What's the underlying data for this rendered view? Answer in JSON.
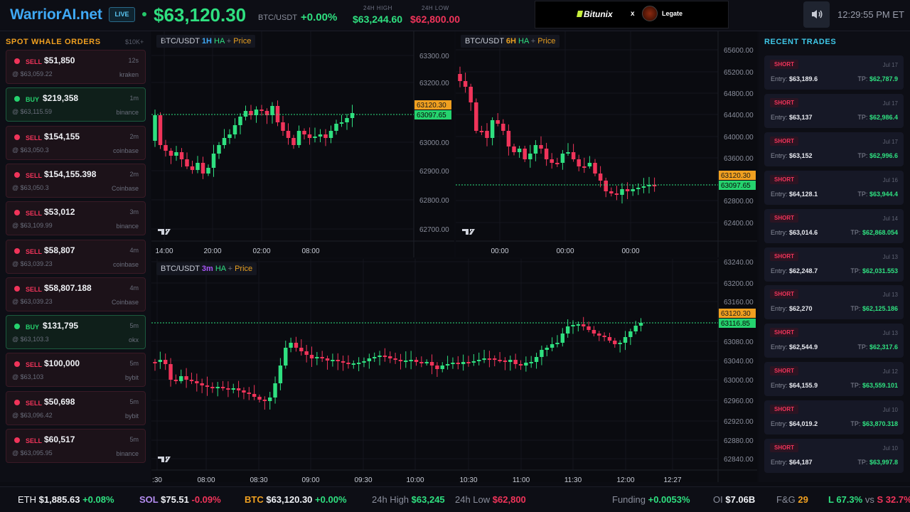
{
  "header": {
    "logo": "WarriorAI.net",
    "live": "LIVE",
    "price": "$63,120.30",
    "pair": "BTC/USDT",
    "change": "+0.00%",
    "high_label": "24H HIGH",
    "high_value": "$63,244.60",
    "low_label": "24H LOW",
    "low_value": "$62,800.00",
    "sponsor_a": "Bitunix",
    "sponsor_x": "x",
    "sponsor_b": "Legate",
    "sound_icon": "speaker-icon",
    "clock": "12:29:55 PM ET",
    "colors": {
      "up": "#2fe080",
      "down": "#f0345a",
      "accent": "#3fa9f5"
    }
  },
  "whale": {
    "title": "SPOT WHALE ORDERS",
    "threshold": "$10K+",
    "orders": [
      {
        "side": "SELL",
        "amount": "$51,850",
        "time": "12s",
        "price": "@ $63,059.22",
        "exchange": "kraken"
      },
      {
        "side": "BUY",
        "amount": "$219,358",
        "time": "1m",
        "price": "@ $63,115.59",
        "exchange": "binance"
      },
      {
        "side": "SELL",
        "amount": "$154,155",
        "time": "2m",
        "price": "@ $63,050.3",
        "exchange": "coinbase"
      },
      {
        "side": "SELL",
        "amount": "$154,155.398",
        "time": "2m",
        "price": "@ $63,050.3",
        "exchange": "Coinbase"
      },
      {
        "side": "SELL",
        "amount": "$53,012",
        "time": "3m",
        "price": "@ $63,109.99",
        "exchange": "binance"
      },
      {
        "side": "SELL",
        "amount": "$58,807",
        "time": "4m",
        "price": "@ $63,039.23",
        "exchange": "coinbase"
      },
      {
        "side": "SELL",
        "amount": "$58,807.188",
        "time": "4m",
        "price": "@ $63,039.23",
        "exchange": "Coinbase"
      },
      {
        "side": "BUY",
        "amount": "$131,795",
        "time": "5m",
        "price": "@ $63,103.3",
        "exchange": "okx"
      },
      {
        "side": "SELL",
        "amount": "$100,000",
        "time": "5m",
        "price": "@ $63,103",
        "exchange": "bybit"
      },
      {
        "side": "SELL",
        "amount": "$50,698",
        "time": "5m",
        "price": "@ $63,096.42",
        "exchange": "bybit"
      },
      {
        "side": "SELL",
        "amount": "$60,517",
        "time": "5m",
        "price": "@ $63,095.95",
        "exchange": "binance"
      }
    ]
  },
  "charts": {
    "h1": {
      "pair": "BTC/USDT",
      "tf": "1H",
      "ha": "HA",
      "plus": "+",
      "price": "Price",
      "yticks": [
        "63300.00",
        "63200.00",
        "63000.00",
        "62900.00",
        "62800.00",
        "62700.00"
      ],
      "xticks": [
        "14:00",
        "20:00",
        "02:00",
        "08:00"
      ],
      "last": "63120.30",
      "cur": "63097.65"
    },
    "h6": {
      "pair": "BTC/USDT",
      "tf": "6H",
      "ha": "HA",
      "plus": "+",
      "price": "Price",
      "yticks": [
        "65600.00",
        "65200.00",
        "64800.00",
        "64400.00",
        "64000.00",
        "63600.00",
        "62800.00",
        "62400.00"
      ],
      "xticks": [
        "00:00",
        "00:00",
        "00:00"
      ],
      "last": "63120.30",
      "cur": "63097.65"
    },
    "m3": {
      "pair": "BTC/USDT",
      "tf": "3m",
      "ha": "HA",
      "plus": "+",
      "price": "Price",
      "yticks": [
        "63240.00",
        "63200.00",
        "63160.00",
        "63080.00",
        "63040.00",
        "63000.00",
        "62960.00",
        "62920.00",
        "62880.00",
        "62840.00"
      ],
      "xticks": [
        ":30",
        "08:00",
        "08:30",
        "09:00",
        "09:30",
        "10:00",
        "10:30",
        "11:00",
        "11:30",
        "12:00",
        "12:27"
      ],
      "last": "63120.30",
      "cur": "63116.85"
    }
  },
  "recent": {
    "title": "RECENT TRADES",
    "entry_label": "Entry:",
    "tp_label": "TP:",
    "trades": [
      {
        "side": "SHORT",
        "date": "Jul 17",
        "entry": "$63,189.6",
        "tp": "$62,787.9"
      },
      {
        "side": "SHORT",
        "date": "Jul 17",
        "entry": "$63,137",
        "tp": "$62,986.4"
      },
      {
        "side": "SHORT",
        "date": "Jul 17",
        "entry": "$63,152",
        "tp": "$62,996.6"
      },
      {
        "side": "SHORT",
        "date": "Jul 16",
        "entry": "$64,128.1",
        "tp": "$63,944.4"
      },
      {
        "side": "SHORT",
        "date": "Jul 14",
        "entry": "$63,014.6",
        "tp": "$62,868.054"
      },
      {
        "side": "SHORT",
        "date": "Jul 13",
        "entry": "$62,248.7",
        "tp": "$62,031.553"
      },
      {
        "side": "SHORT",
        "date": "Jul 13",
        "entry": "$62,270",
        "tp": "$62,125.186"
      },
      {
        "side": "SHORT",
        "date": "Jul 13",
        "entry": "$62,544.9",
        "tp": "$62,317.6"
      },
      {
        "side": "SHORT",
        "date": "Jul 12",
        "entry": "$64,155.9",
        "tp": "$63,559.101"
      },
      {
        "side": "SHORT",
        "date": "Jul 10",
        "entry": "$64,019.2",
        "tp": "$63,870.318"
      },
      {
        "side": "SHORT",
        "date": "Jul 10",
        "entry": "$64,187",
        "tp": "$63,997.8"
      }
    ]
  },
  "ticker": {
    "eth_label": "ETH",
    "eth_price": "$1,885.63",
    "eth_change": "+0.08%",
    "sol_label": "SOL",
    "sol_price": "$75.51",
    "sol_change": "-0.09%",
    "btc_label": "BTC",
    "btc_price": "$63,120.30",
    "btc_change": "+0.00%",
    "high_label": "24h High",
    "high_value": "$63,245",
    "low_label": "24h Low",
    "low_value": "$62,800",
    "funding_label": "Funding",
    "funding_value": "+0.0053%",
    "oi_label": "OI",
    "oi_value": "$7.06B",
    "fg_label": "F&G",
    "fg_value": "29",
    "long_label": "L",
    "long_value": "67.3%",
    "vs": "vs",
    "short_label": "S",
    "short_value": "32.7%"
  }
}
